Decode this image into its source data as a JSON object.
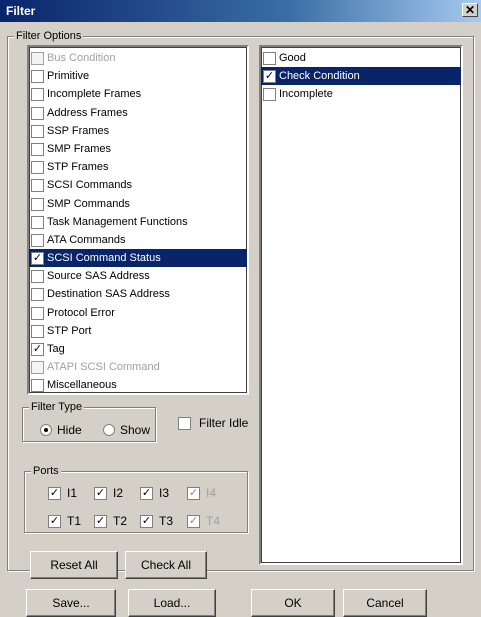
{
  "window": {
    "title": "Filter",
    "close_label": "✕"
  },
  "filter_options": {
    "legend": "Filter Options",
    "items": [
      {
        "label": "Bus Condition",
        "checked": false,
        "disabled": true,
        "selected": false
      },
      {
        "label": "Primitive",
        "checked": false,
        "disabled": false,
        "selected": false
      },
      {
        "label": "Incomplete Frames",
        "checked": false,
        "disabled": false,
        "selected": false
      },
      {
        "label": "Address Frames",
        "checked": false,
        "disabled": false,
        "selected": false
      },
      {
        "label": "SSP Frames",
        "checked": false,
        "disabled": false,
        "selected": false
      },
      {
        "label": "SMP Frames",
        "checked": false,
        "disabled": false,
        "selected": false
      },
      {
        "label": "STP Frames",
        "checked": false,
        "disabled": false,
        "selected": false
      },
      {
        "label": "SCSI Commands",
        "checked": false,
        "disabled": false,
        "selected": false
      },
      {
        "label": "SMP Commands",
        "checked": false,
        "disabled": false,
        "selected": false
      },
      {
        "label": "Task Management Functions",
        "checked": false,
        "disabled": false,
        "selected": false
      },
      {
        "label": "ATA Commands",
        "checked": false,
        "disabled": false,
        "selected": false
      },
      {
        "label": "SCSI Command Status",
        "checked": true,
        "disabled": false,
        "selected": true
      },
      {
        "label": "Source SAS Address",
        "checked": false,
        "disabled": false,
        "selected": false
      },
      {
        "label": "Destination SAS Address",
        "checked": false,
        "disabled": false,
        "selected": false
      },
      {
        "label": "Protocol Error",
        "checked": false,
        "disabled": false,
        "selected": false
      },
      {
        "label": "STP Port",
        "checked": false,
        "disabled": false,
        "selected": false
      },
      {
        "label": "Tag",
        "checked": true,
        "disabled": false,
        "selected": false
      },
      {
        "label": "ATAPI SCSI Command",
        "checked": false,
        "disabled": true,
        "selected": false
      },
      {
        "label": "Miscellaneous",
        "checked": false,
        "disabled": false,
        "selected": false
      }
    ]
  },
  "status_options": {
    "items": [
      {
        "label": "Good",
        "checked": false,
        "selected": false
      },
      {
        "label": "Check Condition",
        "checked": true,
        "selected": true
      },
      {
        "label": "Incomplete",
        "checked": false,
        "selected": false
      }
    ]
  },
  "filter_type": {
    "legend": "Filter Type",
    "hide_label": "Hide",
    "show_label": "Show",
    "selected": "Hide"
  },
  "filter_idle": {
    "label": "Filter Idle",
    "checked": false
  },
  "ports": {
    "legend": "Ports",
    "items": [
      {
        "label": "I1",
        "checked": true,
        "disabled": false
      },
      {
        "label": "I2",
        "checked": true,
        "disabled": false
      },
      {
        "label": "I3",
        "checked": true,
        "disabled": false
      },
      {
        "label": "I4",
        "checked": true,
        "disabled": true
      },
      {
        "label": "T1",
        "checked": true,
        "disabled": false
      },
      {
        "label": "T2",
        "checked": true,
        "disabled": false
      },
      {
        "label": "T3",
        "checked": true,
        "disabled": false
      },
      {
        "label": "T4",
        "checked": true,
        "disabled": true
      }
    ]
  },
  "buttons": {
    "reset_all": "Reset All",
    "check_all": "Check All",
    "save": "Save...",
    "load": "Load...",
    "ok": "OK",
    "cancel": "Cancel"
  }
}
